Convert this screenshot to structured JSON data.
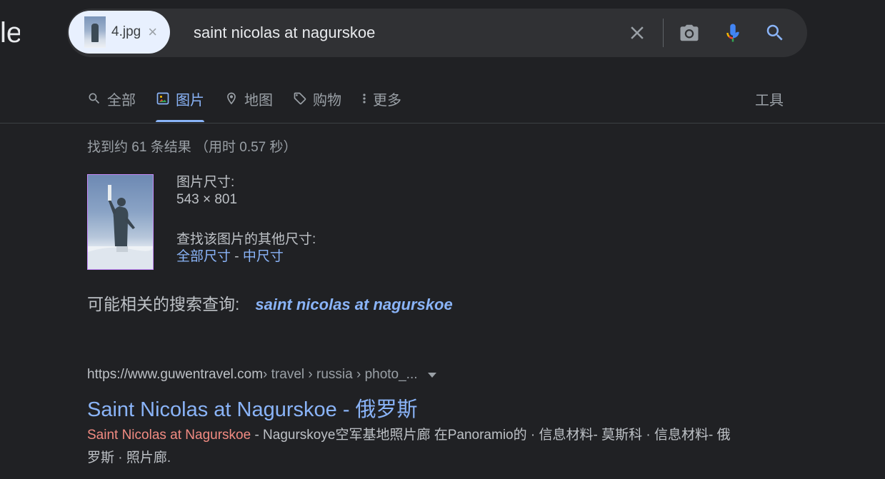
{
  "logo_fragment": "le",
  "search": {
    "image_chip_name": "4.jpg",
    "image_chip_close": "×",
    "query": "saint nicolas at nagurskoe"
  },
  "tabs": [
    {
      "label": "全部",
      "icon": "search-icon"
    },
    {
      "label": "图片",
      "icon": "image-icon",
      "active": true
    },
    {
      "label": "地图",
      "icon": "map-pin-icon"
    },
    {
      "label": "购物",
      "icon": "tag-icon"
    },
    {
      "label": "更多",
      "icon": "more-vert-icon"
    }
  ],
  "tools_label": "工具",
  "stats": "找到约 61 条结果 （用时 0.57 秒）",
  "image_info": {
    "size_label": "图片尺寸:",
    "size_value": "543 × 801",
    "other_sizes_label": "查找该图片的其他尺寸:",
    "all_sizes": "全部尺寸",
    "separator": " - ",
    "medium_size": "中尺寸"
  },
  "related": {
    "label": "可能相关的搜索查询:",
    "query": "saint nicolas at nagurskoe"
  },
  "result": {
    "domain": "https://www.guwentravel.com",
    "path": " › travel › russia › photo_...",
    "title": "Saint Nicolas at Nagurskoe - 俄罗斯",
    "snippet_highlight": "Saint Nicolas at Nagurskoe",
    "snippet_rest": " - Nagurskoye空军基地照片廊 在Panoramio的 · 信息材料- 莫斯科 · 信息材料- 俄罗斯 · 照片廊."
  },
  "colors": {
    "background": "#202124",
    "link": "#8ab4f8",
    "highlight": "#f28b82",
    "active_tab": "#8ab4f8"
  }
}
